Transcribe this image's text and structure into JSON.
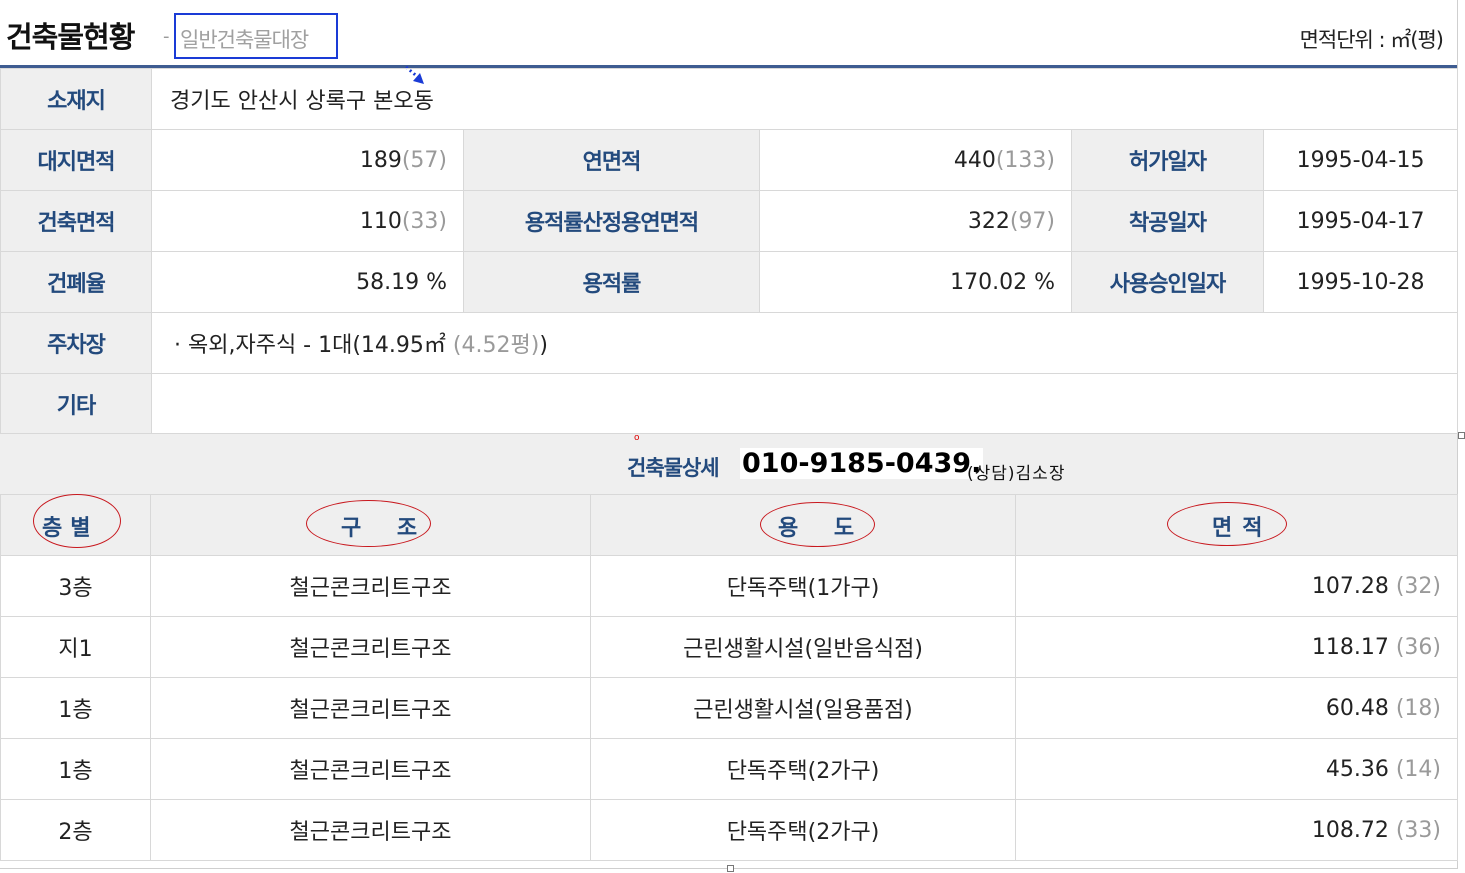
{
  "header": {
    "title": "건축물현황",
    "separator": "-",
    "subtitle": "일반건축물대장",
    "unit": "면적단위 : ㎡(평)"
  },
  "summary": {
    "location_label": "소재지",
    "location_value": "경기도 안산시 상록구 본오동",
    "site_area_label": "대지면적",
    "site_area_m2": "189",
    "site_area_py": "(57)",
    "total_area_label": "연면적",
    "total_area_m2": "440",
    "total_area_py": "(133)",
    "permit_date_label": "허가일자",
    "permit_date": "1995-04-15",
    "building_area_label": "건축면적",
    "building_area_m2": "110",
    "building_area_py": "(33)",
    "far_area_label": "용적률산정용연면적",
    "far_area_m2": "322",
    "far_area_py": "(97)",
    "start_date_label": "착공일자",
    "start_date": "1995-04-17",
    "bcr_label": "건폐율",
    "bcr_value": "58.19 %",
    "far_label": "용적률",
    "far_value": "170.02 %",
    "approval_date_label": "사용승인일자",
    "approval_date": "1995-10-28",
    "parking_label": "주차장",
    "parking_value": "· 옥외,자주식 - 1대(14.95㎡",
    "parking_py": "(4.52평)",
    "parking_close": ")",
    "etc_label": "기타",
    "etc_value": ""
  },
  "detail": {
    "label": "건축물상세",
    "phone": "010-9185-0439.",
    "consult": "(상담)김소장",
    "columns": [
      "층별",
      "구 조",
      "용 도",
      "면적"
    ],
    "rows": [
      {
        "floor": "3층",
        "structure": "철근콘크리트구조",
        "use": "단독주택(1가구)",
        "area": "107.28",
        "area_py": "(32)"
      },
      {
        "floor": "지1",
        "structure": "철근콘크리트구조",
        "use": "근린생활시설(일반음식점)",
        "area": "118.17",
        "area_py": "(36)"
      },
      {
        "floor": "1층",
        "structure": "철근콘크리트구조",
        "use": "근린생활시설(일용품점)",
        "area": "60.48",
        "area_py": "(18)"
      },
      {
        "floor": "1층",
        "structure": "철근콘크리트구조",
        "use": "단독주택(2가구)",
        "area": "45.36",
        "area_py": "(14)"
      },
      {
        "floor": "2층",
        "structure": "철근콘크리트구조",
        "use": "단독주택(2가구)",
        "area": "108.72",
        "area_py": "(33)"
      }
    ]
  },
  "colors": {
    "header_text": "#234a7d",
    "top_rule": "#3e5c91",
    "subtitle_box": "#1a3bd6",
    "annotation_ellipse": "#c8181e",
    "label_bg": "#efefef"
  },
  "icons": {
    "arrow": "blue-dotted-arrow-icon"
  }
}
